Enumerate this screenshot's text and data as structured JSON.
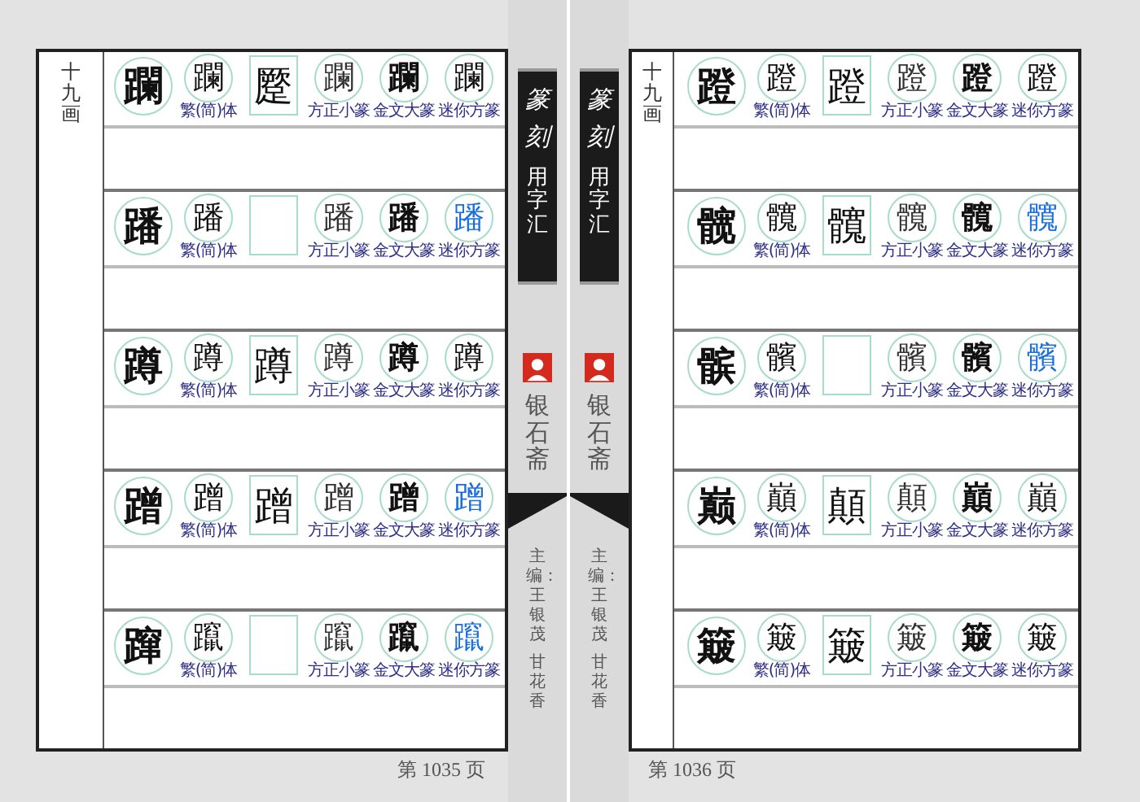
{
  "pages": [
    {
      "stroke_heading": "十九画",
      "page_number": "第 1035 页",
      "rows": [
        {
          "entries": [
            {
              "kind": "head",
              "glyph": "躝"
            },
            {
              "kind": "circle",
              "glyph": "躝",
              "label": "繁(简)体"
            },
            {
              "kind": "square",
              "glyph": "蹷"
            },
            {
              "kind": "circle",
              "glyph": "躝",
              "label": "方正小篆"
            },
            {
              "kind": "circle",
              "glyph": "躝",
              "label": "金文大篆"
            },
            {
              "kind": "circle",
              "glyph": "躝",
              "label": "迷你方篆",
              "color": "#111111"
            }
          ]
        },
        {
          "entries": [
            {
              "kind": "head",
              "glyph": "蹯"
            },
            {
              "kind": "circle",
              "glyph": "蹯",
              "label": "繁(简)体"
            },
            {
              "kind": "blank"
            },
            {
              "kind": "circle",
              "glyph": "蹯",
              "label": "方正小篆"
            },
            {
              "kind": "circle",
              "glyph": "蹯",
              "label": "金文大篆"
            },
            {
              "kind": "circle",
              "glyph": "蹯",
              "label": "迷你方篆",
              "color": "#1a6fe0"
            }
          ]
        },
        {
          "entries": [
            {
              "kind": "head",
              "glyph": "蹲"
            },
            {
              "kind": "circle",
              "glyph": "蹲",
              "label": "繁(简)体"
            },
            {
              "kind": "square",
              "glyph": "蹲"
            },
            {
              "kind": "circle",
              "glyph": "蹲",
              "label": "方正小篆"
            },
            {
              "kind": "circle",
              "glyph": "蹲",
              "label": "金文大篆"
            },
            {
              "kind": "circle",
              "glyph": "蹲",
              "label": "迷你方篆",
              "color": "#111111"
            }
          ]
        },
        {
          "entries": [
            {
              "kind": "head",
              "glyph": "蹭"
            },
            {
              "kind": "circle",
              "glyph": "蹭",
              "label": "繁(简)体"
            },
            {
              "kind": "square",
              "glyph": "蹭"
            },
            {
              "kind": "circle",
              "glyph": "蹭",
              "label": "方正小篆"
            },
            {
              "kind": "circle",
              "glyph": "蹭",
              "label": "金文大篆"
            },
            {
              "kind": "circle",
              "glyph": "蹭",
              "label": "迷你方篆",
              "color": "#1a6fe0"
            }
          ]
        },
        {
          "entries": [
            {
              "kind": "head",
              "glyph": "蹿"
            },
            {
              "kind": "circle",
              "glyph": "躥",
              "label": "繁(简)体"
            },
            {
              "kind": "blank"
            },
            {
              "kind": "circle",
              "glyph": "躥",
              "label": "方正小篆"
            },
            {
              "kind": "circle",
              "glyph": "躥",
              "label": "金文大篆"
            },
            {
              "kind": "circle",
              "glyph": "躥",
              "label": "迷你方篆",
              "color": "#1a6fe0"
            }
          ]
        }
      ]
    },
    {
      "stroke_heading": "十九画",
      "page_number": "第 1036 页",
      "rows": [
        {
          "entries": [
            {
              "kind": "head",
              "glyph": "蹬"
            },
            {
              "kind": "circle",
              "glyph": "蹬",
              "label": "繁(简)体"
            },
            {
              "kind": "square",
              "glyph": "蹬"
            },
            {
              "kind": "circle",
              "glyph": "蹬",
              "label": "方正小篆"
            },
            {
              "kind": "circle",
              "glyph": "蹬",
              "label": "金文大篆"
            },
            {
              "kind": "circle",
              "glyph": "蹬",
              "label": "迷你方篆",
              "color": "#111111"
            }
          ]
        },
        {
          "entries": [
            {
              "kind": "head",
              "glyph": "髋"
            },
            {
              "kind": "circle",
              "glyph": "髖",
              "label": "繁(简)体"
            },
            {
              "kind": "square",
              "glyph": "髖"
            },
            {
              "kind": "circle",
              "glyph": "髖",
              "label": "方正小篆"
            },
            {
              "kind": "circle",
              "glyph": "髖",
              "label": "金文大篆"
            },
            {
              "kind": "circle",
              "glyph": "髖",
              "label": "迷你方篆",
              "color": "#1a6fe0"
            }
          ]
        },
        {
          "entries": [
            {
              "kind": "head",
              "glyph": "髌"
            },
            {
              "kind": "circle",
              "glyph": "髕",
              "label": "繁(简)体"
            },
            {
              "kind": "blank"
            },
            {
              "kind": "circle",
              "glyph": "髕",
              "label": "方正小篆"
            },
            {
              "kind": "circle",
              "glyph": "髕",
              "label": "金文大篆"
            },
            {
              "kind": "circle",
              "glyph": "髕",
              "label": "迷你方篆",
              "color": "#1a6fe0"
            }
          ]
        },
        {
          "entries": [
            {
              "kind": "head",
              "glyph": "巅"
            },
            {
              "kind": "circle",
              "glyph": "巔",
              "label": "繁(简)体"
            },
            {
              "kind": "square",
              "glyph": "顛"
            },
            {
              "kind": "circle",
              "glyph": "顛",
              "label": "方正小篆"
            },
            {
              "kind": "circle",
              "glyph": "巔",
              "label": "金文大篆"
            },
            {
              "kind": "circle",
              "glyph": "巔",
              "label": "迷你方篆",
              "color": "#111111"
            }
          ]
        },
        {
          "entries": [
            {
              "kind": "head",
              "glyph": "簸"
            },
            {
              "kind": "circle",
              "glyph": "簸",
              "label": "繁(简)体"
            },
            {
              "kind": "square",
              "glyph": "簸"
            },
            {
              "kind": "circle",
              "glyph": "簸",
              "label": "方正小篆"
            },
            {
              "kind": "circle",
              "glyph": "簸",
              "label": "金文大篆"
            },
            {
              "kind": "circle",
              "glyph": "簸",
              "label": "迷你方篆",
              "color": "#111111"
            }
          ]
        }
      ]
    }
  ],
  "spines": [
    {
      "title_art": "篆刻",
      "title": "用字汇",
      "publisher": "银石斋",
      "editors_label": "主编：",
      "editors": [
        "王银茂",
        "甘花香"
      ]
    },
    {
      "title_art": "篆刻",
      "title": "用字汇",
      "publisher": "银石斋",
      "editors_label": "主编：",
      "editors": [
        "王银茂",
        "甘花香"
      ]
    }
  ]
}
